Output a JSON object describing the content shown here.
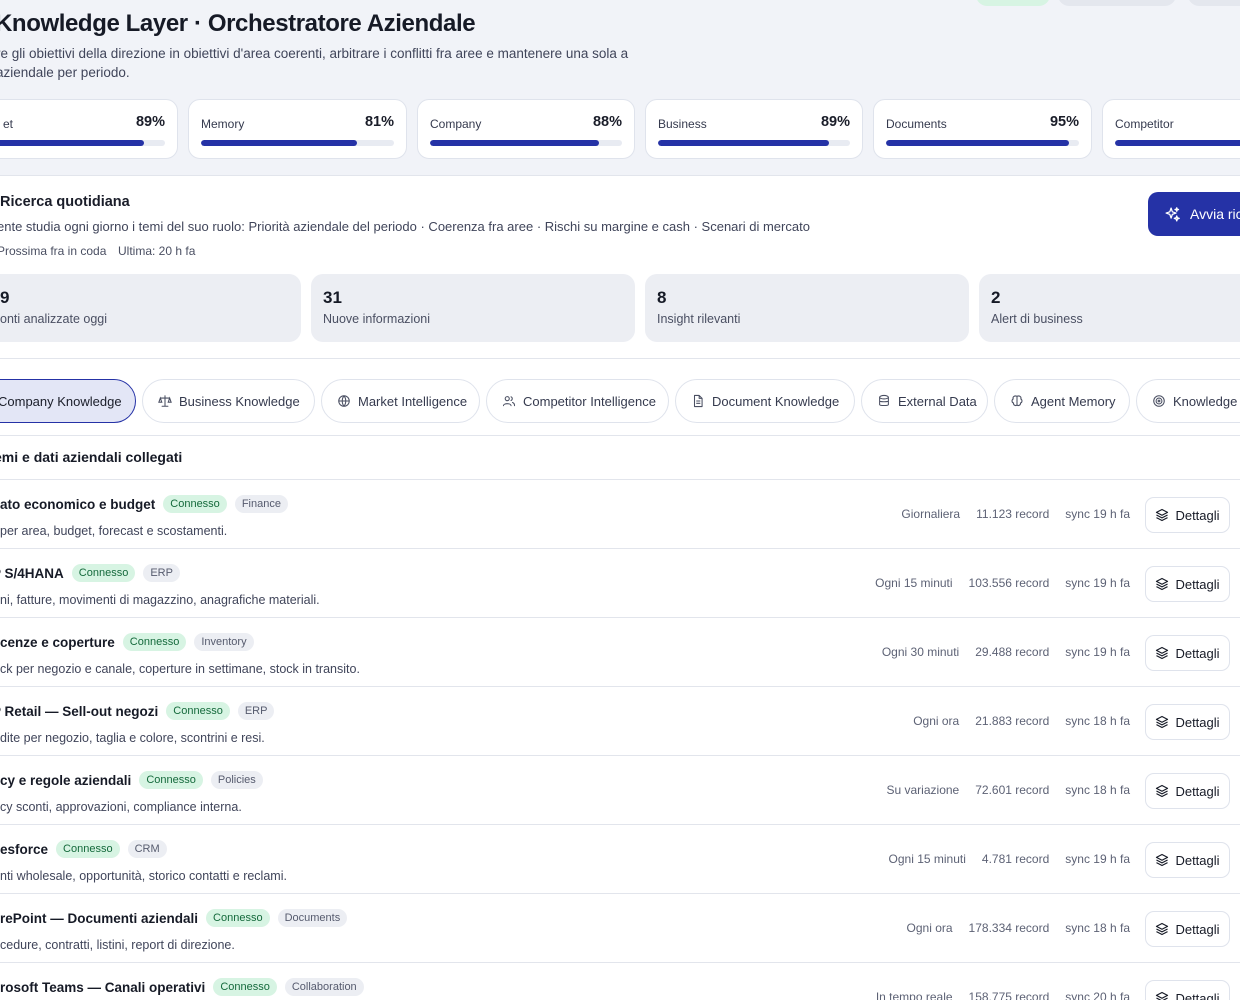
{
  "header": {
    "title": "Knowledge Layer · Orchestratore Aziendale",
    "description": "re gli obiettivi della direzione in obiettivi d'area coerenti, arbitrare i conflitti fra aree e mantenere una sola a aziendale per periodo."
  },
  "metrics": [
    {
      "label": "et",
      "value": "89%",
      "fill": 0.89
    },
    {
      "label": "Memory",
      "value": "81%",
      "fill": 0.81
    },
    {
      "label": "Company",
      "value": "88%",
      "fill": 0.88
    },
    {
      "label": "Business",
      "value": "89%",
      "fill": 0.89
    },
    {
      "label": "Documents",
      "value": "95%",
      "fill": 0.95
    },
    {
      "label": "Competitor",
      "value": "",
      "fill": 0.9
    }
  ],
  "research": {
    "title": "Ricerca quotidiana",
    "description": "ente studia ogni giorno i temi del suo ruolo: Priorità aziendale del periodo · Coerenza fra aree · Rischi su margine e cash · Scenari di mercato",
    "next": "Prossima fra in coda",
    "last": "Ultima: 20 h fa",
    "start_label": "Avvia rice",
    "stats": [
      {
        "value": "9",
        "label": "onti analizzate oggi"
      },
      {
        "value": "31",
        "label": "Nuove informazioni"
      },
      {
        "value": "8",
        "label": "Insight rilevanti"
      },
      {
        "value": "2",
        "label": "Alert di business"
      }
    ]
  },
  "tabs": [
    {
      "label": "Company Knowledge",
      "icon": "building-icon"
    },
    {
      "label": "Business Knowledge",
      "icon": "scale-icon"
    },
    {
      "label": "Market Intelligence",
      "icon": "globe-icon"
    },
    {
      "label": "Competitor Intelligence",
      "icon": "users-icon"
    },
    {
      "label": "Document Knowledge",
      "icon": "document-icon"
    },
    {
      "label": "External Data",
      "icon": "database-icon"
    },
    {
      "label": "Agent Memory",
      "icon": "brain-icon"
    },
    {
      "label": "Knowledge",
      "icon": "target-icon"
    }
  ],
  "systems": {
    "title": "emi e dati aziendali collegati",
    "details_label": "Dettagli",
    "rows": [
      {
        "name": "ato economico e budget",
        "status": "Connesso",
        "category": "Finance",
        "description": "per area, budget, forecast e scostamenti.",
        "frequency": "Giornaliera",
        "records": "11.123 record",
        "sync": "sync 19 h fa"
      },
      {
        "name": "P S/4HANA",
        "status": "Connesso",
        "category": "ERP",
        "description": "ni, fatture, movimenti di magazzino, anagrafiche materiali.",
        "frequency": "Ogni 15 minuti",
        "records": "103.556 record",
        "sync": "sync 19 h fa"
      },
      {
        "name": "cenze e coperture",
        "status": "Connesso",
        "category": "Inventory",
        "description": "ck per negozio e canale, coperture in settimane, stock in transito.",
        "frequency": "Ogni 30 minuti",
        "records": "29.488 record",
        "sync": "sync 19 h fa"
      },
      {
        "name": "P Retail — Sell-out negozi",
        "status": "Connesso",
        "category": "ERP",
        "description": "dite per negozio, taglia e colore, scontrini e resi.",
        "frequency": "Ogni ora",
        "records": "21.883 record",
        "sync": "sync 18 h fa"
      },
      {
        "name": "cy e regole aziendali",
        "status": "Connesso",
        "category": "Policies",
        "description": "cy sconti, approvazioni, compliance interna.",
        "frequency": "Su variazione",
        "records": "72.601 record",
        "sync": "sync 18 h fa"
      },
      {
        "name": "esforce",
        "status": "Connesso",
        "category": "CRM",
        "description": "nti wholesale, opportunità, storico contatti e reclami.",
        "frequency": "Ogni 15 minuti",
        "records": "4.781 record",
        "sync": "sync 19 h fa"
      },
      {
        "name": "rePoint — Documenti aziendali",
        "status": "Connesso",
        "category": "Documents",
        "description": "cedure, contratti, listini, report di direzione.",
        "frequency": "Ogni ora",
        "records": "178.334 record",
        "sync": "sync 18 h fa"
      },
      {
        "name": "rosoft Teams — Canali operativi",
        "status": "Connesso",
        "category": "Collaboration",
        "description": "",
        "frequency": "In tempo reale",
        "records": "158.775 record",
        "sync": "sync 20 h fa"
      }
    ]
  },
  "colors": {
    "accent": "#2532a6",
    "connected_bg": "#d7f4e3",
    "connected_text": "#156a3c"
  }
}
